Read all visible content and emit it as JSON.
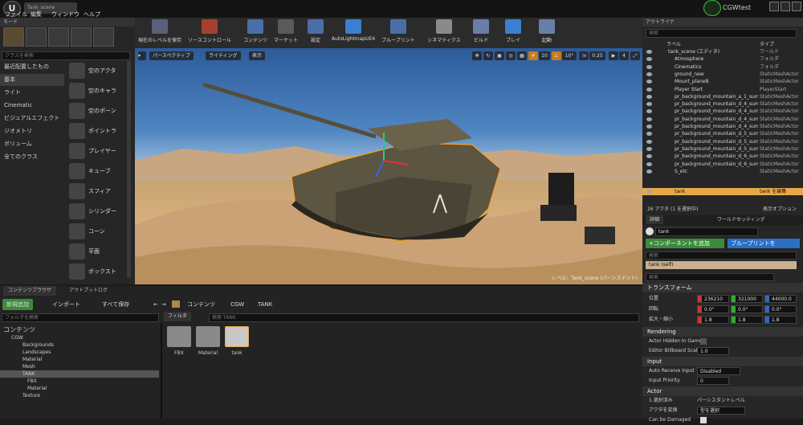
{
  "app": {
    "doc_tab": "Tank_scene",
    "project_name": "CGWtest"
  },
  "menu": [
    "ファイル",
    "編集",
    "ウィンドウ",
    "ヘルプ"
  ],
  "modes": {
    "header": "モード",
    "search_placeholder": "クラスを検索",
    "categories": [
      "最近配置したもの",
      "基本",
      "ライト",
      "Cinematic",
      "ビジュアルエフェクト",
      "ジオメトリ",
      "ボリューム",
      "全てのクラス"
    ],
    "selected_category": "基本",
    "place_items": [
      "空のアクタ",
      "空のキャラ",
      "空のポーン",
      "ポイントラ",
      "プレイヤー",
      "キューブ",
      "スフィア",
      "シリンダー",
      "コーン",
      "平面",
      "ボックスト"
    ]
  },
  "toolbar": {
    "buttons": [
      "現在のレベルを保存",
      "ソースコントロール",
      "コンテンツ",
      "マーケット",
      "設定",
      "AutoLightmapUE4",
      "ブループリント",
      "シネマティクス",
      "ビルド",
      "プレイ",
      "起動"
    ],
    "colors": [
      "#5a5f7a",
      "#a54030",
      "#4a6fa8",
      "#5a5a5a",
      "#4a6fa8",
      "#3a80d0",
      "#4a6fa8",
      "#8a8a8a",
      "#6a7fa8",
      "#3a80d0",
      "#6a7fa8"
    ]
  },
  "viewport": {
    "perspective": "パースペクティブ",
    "lighting": "ライティング",
    "show": "表示",
    "grid_snap": "10",
    "rotate_snap": "10°",
    "scale_snap": "0.25",
    "camera_speed": "4",
    "footer_level_label": "レベル：",
    "footer_level": "Tank_scene (パーシステント)"
  },
  "content_browser": {
    "tabs": [
      "コンテンツブラウザ",
      "アウトプットログ"
    ],
    "add_new": "新規追加",
    "import": "インポート",
    "save_all": "すべて保存",
    "path": [
      "コンテンツ",
      "CGW",
      "TANK"
    ],
    "folder_search_placeholder": "フォルダを検索",
    "filters_label": "フィルタ",
    "asset_search_placeholder": "検索 TANK",
    "tree": [
      "コンテンツ",
      "CGW",
      "Backgrounds",
      "Landscapes",
      "Material",
      "Mesh",
      "TANK",
      "FBX",
      "Material",
      "Texture"
    ],
    "selected_tree": "TANK",
    "assets": [
      "FBX",
      "Material",
      "tank"
    ]
  },
  "outliner": {
    "header": "アウトライナ",
    "search_placeholder": "検索",
    "col_label": "ラベル",
    "col_type": "タイプ",
    "rows": [
      {
        "name": "tank_scene (エディタ)",
        "type": "ワールド"
      },
      {
        "name": "Atmosphere",
        "type": "フォルダ"
      },
      {
        "name": "Cinematics",
        "type": "フォルダ"
      },
      {
        "name": "ground_new",
        "type": "StaticMeshActor"
      },
      {
        "name": "Mount_planeB",
        "type": "StaticMeshActor"
      },
      {
        "name": "Player Start",
        "type": "PlayerStart"
      },
      {
        "name": "pr_background_mountain_a_1_summ",
        "type": "StaticMeshActor"
      },
      {
        "name": "pr_background_mountain_d_4_summ",
        "type": "StaticMeshActor"
      },
      {
        "name": "pr_background_mountain_d_4_summ",
        "type": "StaticMeshActor"
      },
      {
        "name": "pr_background_mountain_d_4_summ",
        "type": "StaticMeshActor"
      },
      {
        "name": "pr_background_mountain_d_4_summ",
        "type": "StaticMeshActor"
      },
      {
        "name": "pr_background_mountain_d_5_summ",
        "type": "StaticMeshActor"
      },
      {
        "name": "pr_background_mountain_d_5_summ",
        "type": "StaticMeshActor"
      },
      {
        "name": "pr_background_mountain_d_5_summ",
        "type": "StaticMeshActor"
      },
      {
        "name": "pr_background_mountain_d_6_summ",
        "type": "StaticMeshActor"
      },
      {
        "name": "pr_background_mountain_d_6_summ",
        "type": "StaticMeshActor"
      },
      {
        "name": "S_etc",
        "type": "StaticMeshActor"
      },
      {
        "name": "tank",
        "type": "tank を編集"
      }
    ],
    "selected_row": "tank",
    "footer_count": "26 アクタ (1 を選択中)",
    "footer_view": "表示オプション"
  },
  "details": {
    "tabs": [
      "詳細",
      "ワールドセッティング"
    ],
    "actor_name": "tank",
    "add_component": "+コンポーネントを追加",
    "blueprint_button": "ブループリントを",
    "search_placeholder": "検索",
    "component": "tank (self)",
    "transform_header": "トランスフォーム",
    "location_label": "位置",
    "location": [
      "236210",
      "321000",
      "44000.0"
    ],
    "rotation_label": "回転",
    "rotation": [
      "0.0°",
      "0.0°",
      "0.0°"
    ],
    "scale_label": "拡大・縮小",
    "scale": [
      "1.8",
      "1.8",
      "1.8"
    ],
    "rendering_header": "Rendering",
    "hidden_label": "Actor Hidden In Game",
    "billboard_label": "Editor Billboard Scale",
    "billboard_value": "1.0",
    "input_header": "Input",
    "auto_receive_label": "Auto Receive Input",
    "auto_receive_value": "Disabled",
    "input_priority_label": "Input Priority",
    "input_priority_value": "0",
    "actor_header": "Actor",
    "selected_in_label": "1.選択済み",
    "selected_in_value": "パーシスタントレベル",
    "convert_label": "アクタを変換",
    "convert_value": "型を選択",
    "can_be_damaged": "Can be Damaged"
  }
}
